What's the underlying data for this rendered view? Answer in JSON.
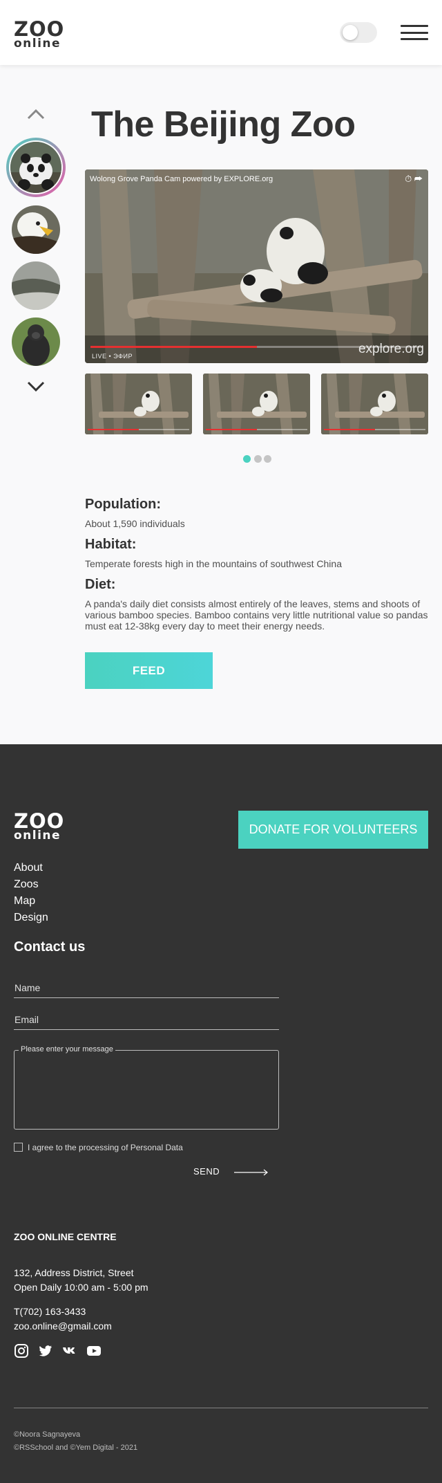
{
  "header": {
    "logo_top": "ZOO",
    "logo_bottom": "online"
  },
  "zoo": {
    "title": "The Beijing Zoo",
    "video": {
      "title": "Wolong Grove Panda Cam powered by EXPLORE.org",
      "watermark": "explore.org",
      "live_label": "LIVE  •  ЭФИР",
      "progress": 0.5
    },
    "carousel": {
      "animals": [
        "panda",
        "eagle",
        "alligator",
        "gorilla"
      ],
      "active_index": 0,
      "dots": 3,
      "active_dot": 0
    },
    "info": {
      "population_heading": "Population:",
      "population_text": "About 1,590 individuals",
      "habitat_heading": "Habitat:",
      "habitat_text": "Temperate forests high in the mountains of southwest China",
      "diet_heading": "Diet:",
      "diet_text": "A panda's daily diet consists almost entirely of the leaves, stems and shoots of various bamboo species. Bamboo contains very little nutritional value so pandas must eat 12-38kg every day to meet their energy needs."
    },
    "feed_label": "FEED"
  },
  "footer": {
    "logo_top": "ZOO",
    "logo_bottom": "online",
    "donate_label": "DONATE FOR VOLUNTEERS",
    "nav": [
      "About",
      "Zoos",
      "Map",
      "Design"
    ],
    "contact_title": "Contact us",
    "name_placeholder": "Name",
    "email_placeholder": "Email",
    "message_placeholder": "Please enter your message",
    "agree_label": "I agree to the processing of Personal Data",
    "send_label": "SEND",
    "centre_title": "ZOO ONLINE CENTRE",
    "address": "132, Address District, Street",
    "hours": "Open Daily 10:00 am - 5:00 pm",
    "phone": "T(702) 163-3433",
    "email": "zoo.online@gmail.com",
    "social": [
      "instagram-icon",
      "twitter-icon",
      "vk-icon",
      "youtube-icon"
    ],
    "copyright_1": "©Noora Sagnayeva",
    "copyright_2": "©RSSchool and ©Yem Digital - 2021"
  },
  "colors": {
    "accent": "#4bd2c0",
    "dark": "#333333",
    "progress_red": "#e53030"
  }
}
